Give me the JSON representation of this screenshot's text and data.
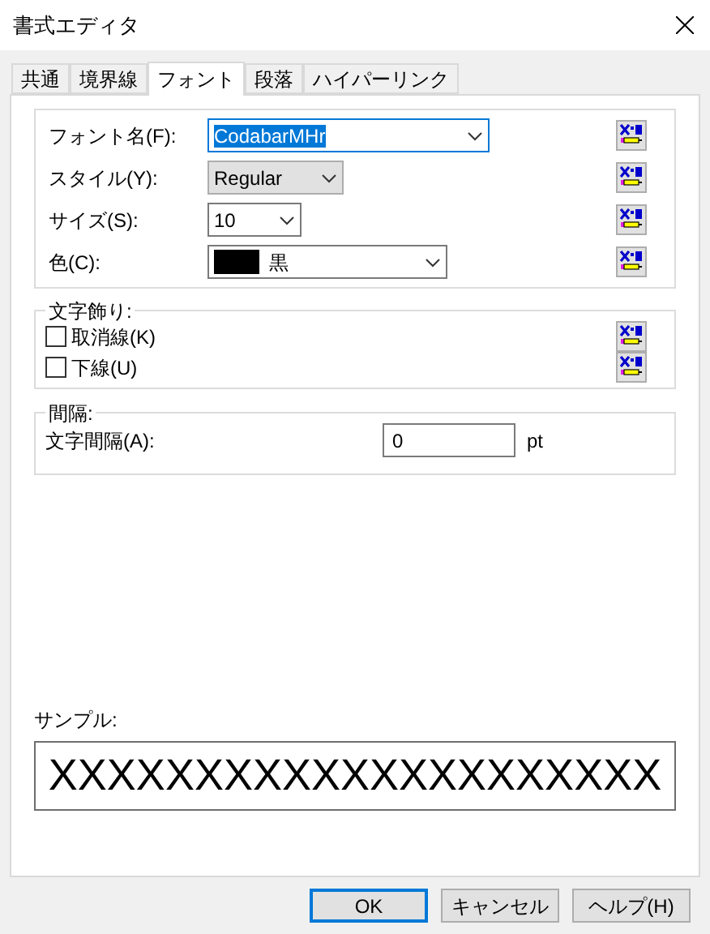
{
  "window": {
    "title": "書式エディタ"
  },
  "tabs": [
    {
      "label": "共通",
      "selected": false
    },
    {
      "label": "境界線",
      "selected": false
    },
    {
      "label": "フォント",
      "selected": true
    },
    {
      "label": "段落",
      "selected": false
    },
    {
      "label": "ハイパーリンク",
      "selected": false
    }
  ],
  "font_fields": [
    {
      "label": "フォント名(F):",
      "kind": "editable",
      "value": "CodabarMHr",
      "focused": true
    },
    {
      "label": "スタイル(Y):",
      "kind": "dropdown",
      "value": "Regular",
      "focused": false
    },
    {
      "label": "サイズ(S):",
      "kind": "editable",
      "value": "10",
      "focused": false
    },
    {
      "label": "色(C):",
      "kind": "color",
      "value": "黒",
      "color": "#000000",
      "focused": false
    }
  ],
  "decoration": {
    "title": "文字飾り:",
    "options": [
      {
        "label": "取消線(K)",
        "checked": false
      },
      {
        "label": "下線(U)",
        "checked": false
      }
    ]
  },
  "spacing": {
    "title": "間隔:",
    "label": "文字間隔(A):",
    "value": "0",
    "unit": "pt"
  },
  "sample": {
    "label": "サンプル:",
    "text": "XXXXXXXXXXXXXXXXXXXXX"
  },
  "buttons": [
    {
      "label": "OK",
      "default": true
    },
    {
      "label": "キャンセル",
      "default": false
    },
    {
      "label": "ヘルプ(H)",
      "default": false
    }
  ]
}
